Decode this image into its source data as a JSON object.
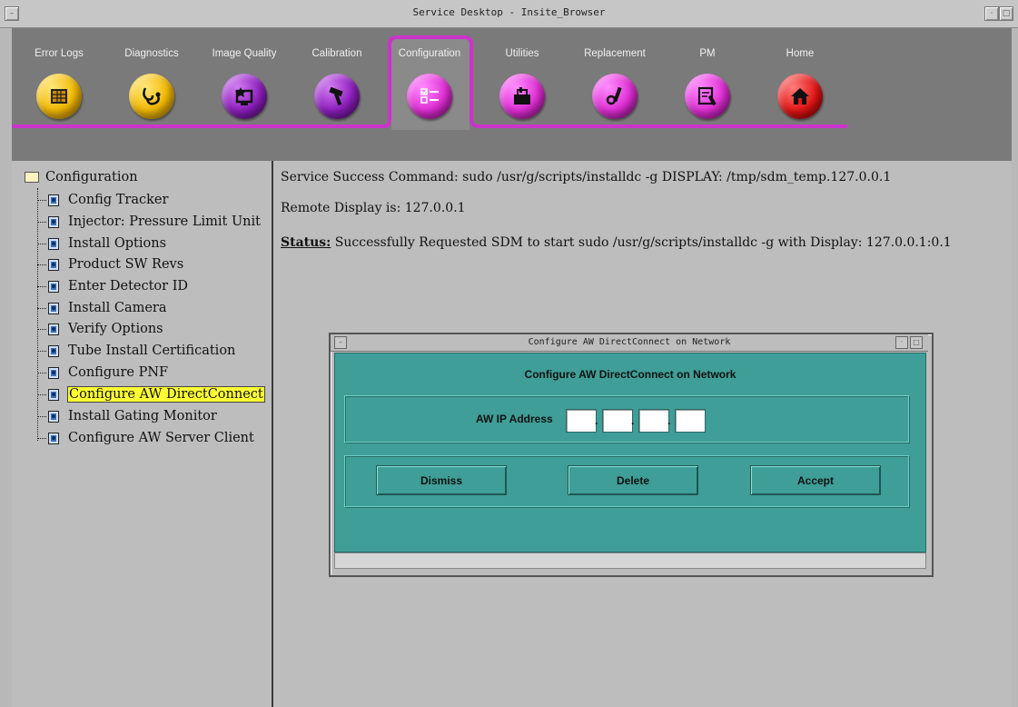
{
  "window": {
    "title": "Service Desktop - Insite_Browser"
  },
  "toolbar": {
    "tabs": [
      {
        "label": "Error Logs",
        "icon": "error-log-icon",
        "color": "#f2b800"
      },
      {
        "label": "Diagnostics",
        "icon": "stethoscope-icon",
        "color": "#f2b800"
      },
      {
        "label": "Image Quality",
        "icon": "monitor-star-icon",
        "color": "#8d1ebd"
      },
      {
        "label": "Calibration",
        "icon": "hammer-icon",
        "color": "#8d1ebd"
      },
      {
        "label": "Configuration",
        "icon": "checklist-icon",
        "color": "#e02ed4",
        "active": true
      },
      {
        "label": "Utilities",
        "icon": "toolbox-icon",
        "color": "#e02ed4"
      },
      {
        "label": "Replacement",
        "icon": "wrench-icon",
        "color": "#e02ed4"
      },
      {
        "label": "PM",
        "icon": "calendar-wrench-icon",
        "color": "#e02ed4"
      },
      {
        "label": "Home",
        "icon": "home-icon",
        "color": "#e21616"
      }
    ],
    "accent_color": "#cc33cc"
  },
  "tree": {
    "root": "Configuration",
    "items": [
      {
        "label": "Config Tracker"
      },
      {
        "label": "Injector: Pressure Limit Unit"
      },
      {
        "label": "Install Options"
      },
      {
        "label": "Product SW Revs"
      },
      {
        "label": "Enter Detector ID"
      },
      {
        "label": "Install Camera"
      },
      {
        "label": "Verify Options"
      },
      {
        "label": "Tube Install Certification"
      },
      {
        "label": "Configure PNF"
      },
      {
        "label": "Configure AW DirectConnect",
        "selected": true
      },
      {
        "label": "Install Gating Monitor"
      },
      {
        "label": "Configure AW Server Client"
      }
    ]
  },
  "main": {
    "command_line": "Service Success Command: sudo /usr/g/scripts/installdc -g DISPLAY: /tmp/sdm_temp.127.0.0.1",
    "remote_display": "Remote Display is: 127.0.0.1",
    "status_label": "Status:",
    "status_text": " Successfully Requested SDM to start sudo /usr/g/scripts/installdc -g with Display: 127.0.0.1:0.1"
  },
  "dialog": {
    "window_title": "Configure AW DirectConnect on Network",
    "heading": "Configure AW DirectConnect on Network",
    "ip_label": "AW IP Address",
    "ip_octets": [
      "",
      "",
      "",
      ""
    ],
    "buttons": {
      "dismiss": "Dismiss",
      "delete": "Delete",
      "accept": "Accept"
    },
    "body_color": "#3f9e97"
  }
}
